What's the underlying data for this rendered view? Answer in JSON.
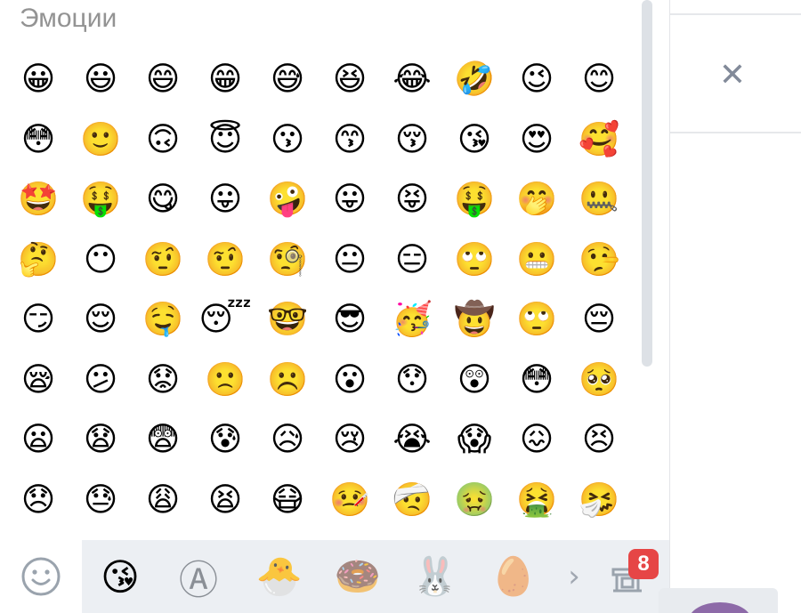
{
  "section": {
    "title": "Эмоции"
  },
  "emojis": [
    "😀",
    "😃",
    "😄",
    "😁",
    "😅",
    "😆",
    "😂",
    "🤣",
    "😉",
    "😊",
    "😳",
    "🙂",
    "🙃",
    "😇",
    "😗",
    "😙",
    "😚",
    "😘",
    "😍",
    "🥰",
    "🤩",
    "🤑",
    "😋",
    "😛",
    "🤪",
    "😛",
    "😝",
    "🤑",
    "🤭",
    "🤐",
    "🤔",
    "😶",
    "🤨",
    "🤨",
    "🧐",
    "😐",
    "😑",
    "🙄",
    "😬",
    "🤥",
    "😏",
    "😌",
    "🤤",
    "😴",
    "🤓",
    "😎",
    "🥳",
    "🤠",
    "🙄",
    "😔",
    "😪",
    "😕",
    "😟",
    "🙁",
    "☹️",
    "😮",
    "😯",
    "😲",
    "😳",
    "🥺",
    "😦",
    "😧",
    "😨",
    "😰",
    "😥",
    "😢",
    "😭",
    "😱",
    "😖",
    "😣",
    "😞",
    "😓",
    "😩",
    "😫",
    "😷",
    "🤒",
    "🤕",
    "🤢",
    "🤮",
    "🤧"
  ],
  "close_glyph": "✕",
  "bottom_bar": {
    "emoji_tab_icon": "smiley-outline-icon",
    "stickers": [
      {
        "icon": "kiss-sticker-icon",
        "glyph": "😘"
      },
      {
        "icon": "avengers-sticker-icon",
        "glyph": "Ⓐ"
      },
      {
        "icon": "chick-sticker-icon",
        "glyph": "🐣"
      },
      {
        "icon": "donut-sticker-icon",
        "glyph": "🍩"
      },
      {
        "icon": "bunny-sticker-icon",
        "glyph": "🐰"
      },
      {
        "icon": "egg-sticker-icon",
        "glyph": "🥚"
      }
    ],
    "next_glyph": "›",
    "store_icon": "sticker-store-icon",
    "store_badge": "8"
  },
  "colors": {
    "accent_badge": "#e64646",
    "sticker_bar_bg": "#eceff3",
    "title_gray": "#939393"
  }
}
